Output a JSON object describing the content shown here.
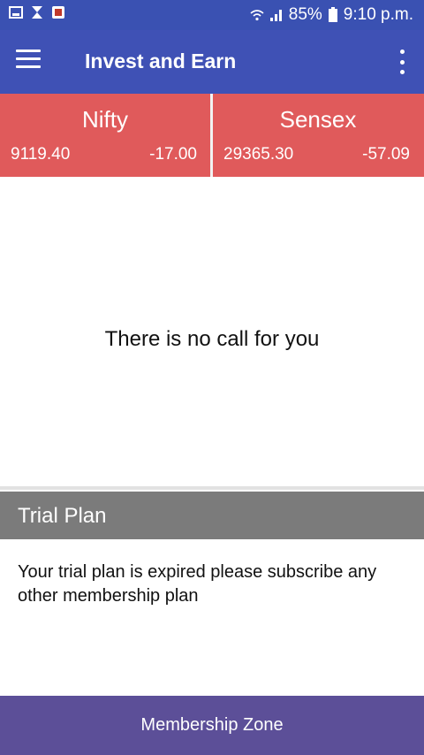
{
  "status_bar": {
    "battery": "85%",
    "time": "9:10 p.m."
  },
  "app_bar": {
    "title": "Invest and Earn"
  },
  "markets": [
    {
      "name": "Nifty",
      "value": "9119.40",
      "change": "-17.00"
    },
    {
      "name": "Sensex",
      "value": "29365.30",
      "change": "-57.09"
    }
  ],
  "calls": {
    "empty_message": "There is no call for you"
  },
  "trial_plan": {
    "title": "Trial Plan",
    "message": "Your trial plan is expired please subscribe any other membership plan"
  },
  "footer": {
    "button_label": "Membership Zone"
  },
  "colors": {
    "status_bar": "#3a51b2",
    "app_bar": "#3f51b5",
    "ticker": "#e05a5b",
    "plan_header": "#7b7b7b",
    "footer": "#5c4f98"
  }
}
